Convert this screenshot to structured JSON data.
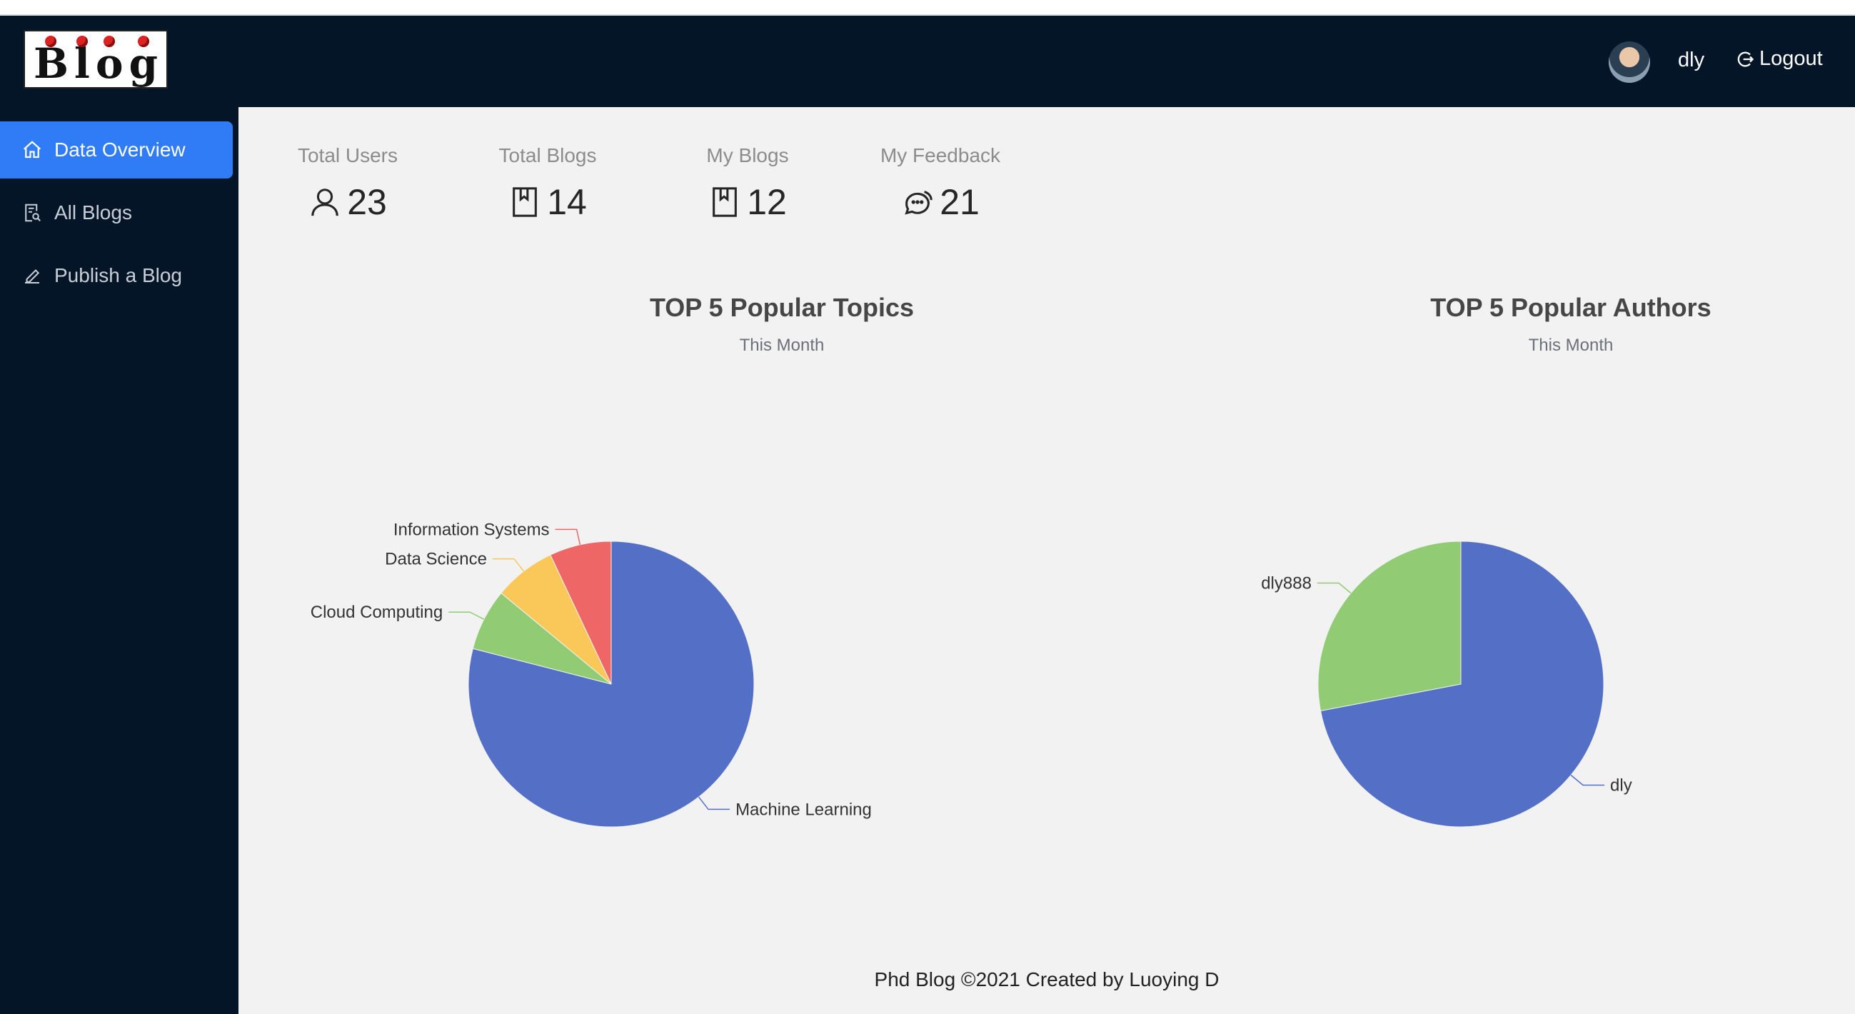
{
  "header": {
    "logo_text": "Blog",
    "username": "dly",
    "logout_label": "Logout"
  },
  "sidebar": {
    "items": [
      {
        "label": "Data Overview",
        "icon": "home-icon",
        "active": true
      },
      {
        "label": "All Blogs",
        "icon": "document-search-icon",
        "active": false
      },
      {
        "label": "Publish a Blog",
        "icon": "edit-pen-icon",
        "active": false
      }
    ]
  },
  "stats": [
    {
      "label": "Total Users",
      "value": "23",
      "icon": "user-icon"
    },
    {
      "label": "Total Blogs",
      "value": "14",
      "icon": "book-icon"
    },
    {
      "label": "My Blogs",
      "value": "12",
      "icon": "book-icon"
    },
    {
      "label": "My Feedback",
      "value": "21",
      "icon": "chat-bubbles-icon"
    }
  ],
  "colors": {
    "header_bg": "#051528",
    "sidebar_active": "#2f7cf6",
    "pie_blue": "#5470c6",
    "pie_green": "#91cc75",
    "pie_yellow": "#fac858",
    "pie_red": "#ee6666"
  },
  "chart_data": [
    {
      "type": "pie",
      "title": "TOP 5 Popular Topics",
      "subtitle": "This Month",
      "categories": [
        "Machine Learning",
        "Cloud Computing",
        "Data Science",
        "Information Systems"
      ],
      "values": [
        79,
        7,
        7,
        7
      ]
    },
    {
      "type": "pie",
      "title": "TOP 5 Popular Authors",
      "subtitle": "This Month",
      "categories": [
        "dly",
        "dly888"
      ],
      "values": [
        72,
        28
      ]
    }
  ],
  "footer": {
    "text": "Phd Blog ©2021 Created by Luoying D"
  }
}
